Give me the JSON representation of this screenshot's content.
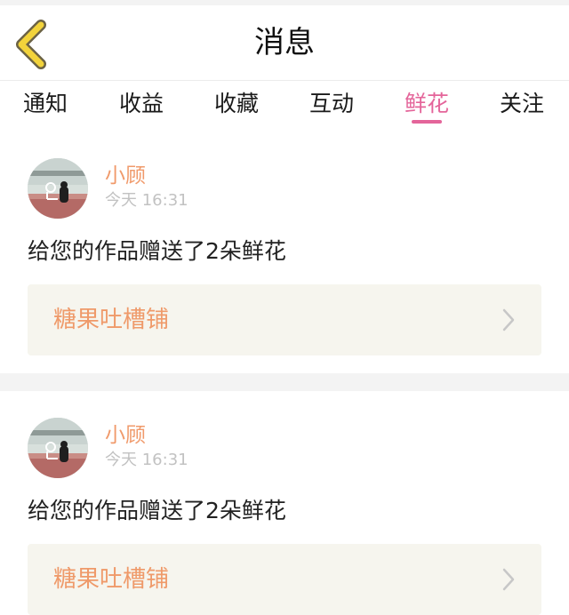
{
  "nav": {
    "title": "消息",
    "back_icon": "chevron-left-icon",
    "back_color": "#f2d33b"
  },
  "tabs": [
    {
      "label": "通知",
      "active": false
    },
    {
      "label": "收益",
      "active": false
    },
    {
      "label": "收藏",
      "active": false
    },
    {
      "label": "互动",
      "active": false
    },
    {
      "label": "鲜花",
      "active": true
    },
    {
      "label": "关注",
      "active": false
    }
  ],
  "messages": [
    {
      "username": "小顾",
      "time": "今天 16:31",
      "text": "给您的作品赠送了2朵鲜花",
      "work_title": "糖果吐槽铺",
      "arrow_icon": "chevron-right-icon"
    },
    {
      "username": "小顾",
      "time": "今天 16:31",
      "text": "给您的作品赠送了2朵鲜花",
      "work_title": "糖果吐槽铺",
      "arrow_icon": "chevron-right-icon"
    }
  ],
  "colors": {
    "accent": "#e4659a",
    "username": "#f09a6b",
    "work_title": "#ef9a6a",
    "work_box_bg": "#f6f5ee"
  }
}
